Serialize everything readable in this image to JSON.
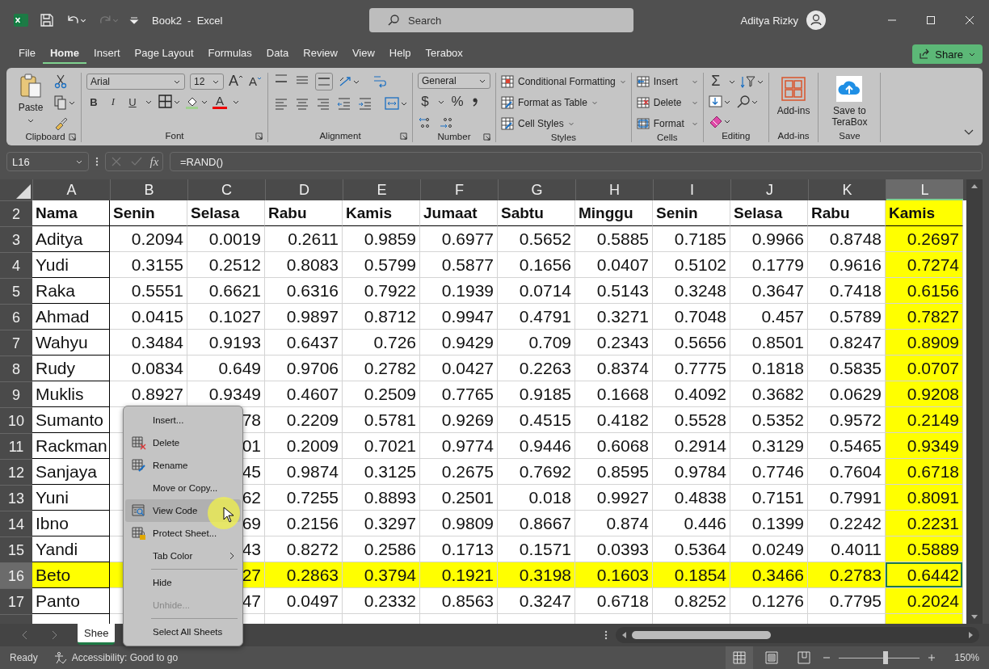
{
  "window": {
    "title": "Book2  -  Excel",
    "user": "Aditya Rizky"
  },
  "search": {
    "placeholder": "Search"
  },
  "tabs": [
    {
      "label": "File",
      "selected": false
    },
    {
      "label": "Home",
      "selected": true
    },
    {
      "label": "Insert",
      "selected": false
    },
    {
      "label": "Page Layout",
      "selected": false
    },
    {
      "label": "Formulas",
      "selected": false
    },
    {
      "label": "Data",
      "selected": false
    },
    {
      "label": "Review",
      "selected": false
    },
    {
      "label": "View",
      "selected": false
    },
    {
      "label": "Help",
      "selected": false
    },
    {
      "label": "Terabox",
      "selected": false
    }
  ],
  "share": "Share",
  "ribbon": {
    "clipboard": {
      "paste": "Paste",
      "label": "Clipboard"
    },
    "font": {
      "name": "Arial",
      "size": "12",
      "grow": "A",
      "shrink": "A",
      "bold": "B",
      "italic": "I",
      "underline": "U",
      "font_color_button": "A",
      "label": "Font"
    },
    "alignment": {
      "label": "Alignment"
    },
    "number": {
      "format": "General",
      "currency": "$",
      "percent": "%",
      "label": "Number"
    },
    "styles": {
      "items": [
        "Conditional Formatting",
        "Format as Table",
        "Cell Styles"
      ],
      "label": "Styles"
    },
    "cells": {
      "items": [
        "Insert",
        "Delete",
        "Format"
      ],
      "label": "Cells"
    },
    "editing": {
      "sum": "Σ",
      "label": "Editing"
    },
    "addins": {
      "button": "Add-ins",
      "label": "Add-ins"
    },
    "save": {
      "button": "Save to TeraBox",
      "label": "Save"
    }
  },
  "formula_bar": {
    "name_box": "L16",
    "fx": "fx",
    "formula": "=RAND()"
  },
  "sheet": {
    "columns": [
      {
        "label": "A",
        "selected": false,
        "highlighted": false
      },
      {
        "label": "B",
        "selected": false,
        "highlighted": false
      },
      {
        "label": "C",
        "selected": false,
        "highlighted": false
      },
      {
        "label": "D",
        "selected": false,
        "highlighted": false
      },
      {
        "label": "E",
        "selected": false,
        "highlighted": false
      },
      {
        "label": "F",
        "selected": false,
        "highlighted": false
      },
      {
        "label": "G",
        "selected": false,
        "highlighted": false
      },
      {
        "label": "H",
        "selected": false,
        "highlighted": false
      },
      {
        "label": "I",
        "selected": false,
        "highlighted": false
      },
      {
        "label": "J",
        "selected": false,
        "highlighted": false
      },
      {
        "label": "K",
        "selected": false,
        "highlighted": false
      },
      {
        "label": "L",
        "selected": true,
        "highlighted": true
      }
    ],
    "header_row": {
      "number": "2",
      "cells": [
        "Nama",
        "Senin",
        "Selasa",
        "Rabu",
        "Kamis",
        "Jumaat",
        "Sabtu",
        "Minggu",
        "Senin",
        "Selasa",
        "Rabu",
        "Kamis"
      ]
    },
    "rows": [
      {
        "number": "3",
        "selected": false,
        "highlighted": false,
        "cells": [
          "Aditya",
          "0.2094",
          "0.0019",
          "0.2611",
          "0.9859",
          "0.6977",
          "0.5652",
          "0.5885",
          "0.7185",
          "0.9966",
          "0.8748",
          "0.2697"
        ]
      },
      {
        "number": "4",
        "selected": false,
        "highlighted": false,
        "cells": [
          "Yudi",
          "0.3155",
          "0.2512",
          "0.8083",
          "0.5799",
          "0.5877",
          "0.1656",
          "0.0407",
          "0.5102",
          "0.1779",
          "0.9616",
          "0.7274"
        ]
      },
      {
        "number": "5",
        "selected": false,
        "highlighted": false,
        "cells": [
          "Raka",
          "0.5551",
          "0.6621",
          "0.6316",
          "0.7922",
          "0.1939",
          "0.0714",
          "0.5143",
          "0.3248",
          "0.3647",
          "0.7418",
          "0.6156"
        ]
      },
      {
        "number": "6",
        "selected": false,
        "highlighted": false,
        "cells": [
          "Ahmad",
          "0.0415",
          "0.1027",
          "0.9897",
          "0.8712",
          "0.9947",
          "0.4791",
          "0.3271",
          "0.7048",
          "0.457",
          "0.5789",
          "0.7827"
        ]
      },
      {
        "number": "7",
        "selected": false,
        "highlighted": false,
        "cells": [
          "Wahyu",
          "0.3484",
          "0.9193",
          "0.6437",
          "0.726",
          "0.9429",
          "0.709",
          "0.2343",
          "0.5656",
          "0.8501",
          "0.8247",
          "0.8909"
        ]
      },
      {
        "number": "8",
        "selected": false,
        "highlighted": false,
        "cells": [
          "Rudy",
          "0.0834",
          "0.649",
          "0.9706",
          "0.2782",
          "0.0427",
          "0.2263",
          "0.8374",
          "0.7775",
          "0.1818",
          "0.5835",
          "0.0707"
        ]
      },
      {
        "number": "9",
        "selected": false,
        "highlighted": false,
        "cells": [
          "Muklis",
          "0.8927",
          "0.9349",
          "0.4607",
          "0.2509",
          "0.7765",
          "0.9185",
          "0.1668",
          "0.4092",
          "0.3682",
          "0.0629",
          "0.9208"
        ]
      },
      {
        "number": "10",
        "selected": false,
        "highlighted": false,
        "cells": [
          "Sumanto",
          null,
          "78",
          "0.2209",
          "0.5781",
          "0.9269",
          "0.4515",
          "0.4182",
          "0.5528",
          "0.5352",
          "0.9572",
          "0.2149"
        ]
      },
      {
        "number": "11",
        "selected": false,
        "highlighted": false,
        "cells": [
          "Rackman",
          null,
          "01",
          "0.2009",
          "0.7021",
          "0.9774",
          "0.9446",
          "0.6068",
          "0.2914",
          "0.3129",
          "0.5465",
          "0.9349"
        ]
      },
      {
        "number": "12",
        "selected": false,
        "highlighted": false,
        "cells": [
          "Sanjaya",
          null,
          "45",
          "0.9874",
          "0.3125",
          "0.2675",
          "0.7692",
          "0.8595",
          "0.9784",
          "0.7746",
          "0.7604",
          "0.6718"
        ]
      },
      {
        "number": "13",
        "selected": false,
        "highlighted": false,
        "cells": [
          "Yuni",
          null,
          "62",
          "0.7255",
          "0.8893",
          "0.2501",
          "0.018",
          "0.9927",
          "0.4838",
          "0.7151",
          "0.7991",
          "0.8091"
        ]
      },
      {
        "number": "14",
        "selected": false,
        "highlighted": false,
        "cells": [
          "Ibno",
          null,
          "69",
          "0.2156",
          "0.3297",
          "0.9809",
          "0.8667",
          "0.874",
          "0.446",
          "0.1399",
          "0.2242",
          "0.2231"
        ]
      },
      {
        "number": "15",
        "selected": false,
        "highlighted": false,
        "cells": [
          "Yandi",
          null,
          "43",
          "0.8272",
          "0.2586",
          "0.1713",
          "0.1571",
          "0.0393",
          "0.5364",
          "0.0249",
          "0.4011",
          "0.5889"
        ]
      },
      {
        "number": "16",
        "selected": true,
        "highlighted": true,
        "cells": [
          "Beto",
          null,
          "27",
          "0.2863",
          "0.3794",
          "0.1921",
          "0.3198",
          "0.1603",
          "0.1854",
          "0.3466",
          "0.2783",
          "0.6442"
        ]
      },
      {
        "number": "17",
        "selected": false,
        "highlighted": false,
        "cells": [
          "Panto",
          null,
          "47",
          "0.0497",
          "0.2332",
          "0.8563",
          "0.3247",
          "0.6718",
          "0.8252",
          "0.1276",
          "0.7795",
          "0.2024"
        ]
      }
    ]
  },
  "context_menu": {
    "items": [
      {
        "kind": "plain",
        "label": "Insert...",
        "hovered": false,
        "disabled": false
      },
      {
        "kind": "delete",
        "label": "Delete",
        "hovered": false,
        "disabled": false
      },
      {
        "kind": "rename",
        "label": "Rename",
        "hovered": false,
        "disabled": false
      },
      {
        "kind": "plain",
        "label": "Move or Copy...",
        "hovered": false,
        "disabled": false
      },
      {
        "kind": "code",
        "label": "View Code",
        "hovered": true,
        "disabled": false
      },
      {
        "kind": "protect",
        "label": "Protect Sheet...",
        "hovered": false,
        "disabled": false
      },
      {
        "kind": "submenu",
        "label": "Tab Color",
        "hovered": false,
        "disabled": false
      },
      {
        "kind": "separator"
      },
      {
        "kind": "plain",
        "label": "Hide",
        "hovered": false,
        "disabled": false
      },
      {
        "kind": "plain",
        "label": "Unhide...",
        "hovered": false,
        "disabled": true
      },
      {
        "kind": "separator"
      },
      {
        "kind": "plain",
        "label": "Select All Sheets",
        "hovered": false,
        "disabled": false
      }
    ]
  },
  "sheet_tabs": [
    {
      "label": "Shee",
      "selected": true
    }
  ],
  "status_bar": {
    "ready": "Ready",
    "accessibility": "Accessibility: Good to go",
    "views": [
      {
        "kind": "normal",
        "selected": true
      },
      {
        "kind": "layout",
        "selected": false
      },
      {
        "kind": "break",
        "selected": false
      }
    ],
    "zoom": {
      "level": 0.58,
      "label": "150%"
    }
  }
}
